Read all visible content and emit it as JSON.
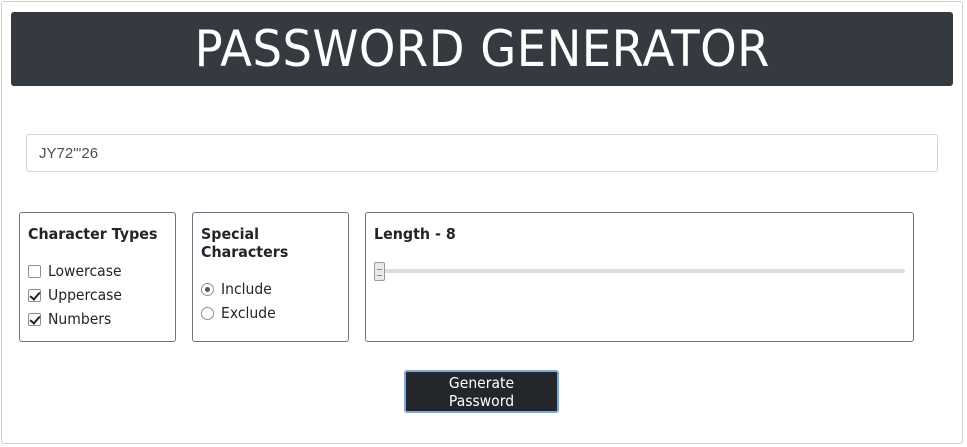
{
  "header": {
    "title": "PASSWORD GENERATOR"
  },
  "output": {
    "value": "JY72\"'26"
  },
  "character_types": {
    "heading": "Character Types",
    "options": [
      {
        "label": "Lowercase",
        "checked": false
      },
      {
        "label": "Uppercase",
        "checked": true
      },
      {
        "label": "Numbers",
        "checked": true
      }
    ]
  },
  "special_characters": {
    "heading": "Special Characters",
    "options": [
      {
        "label": "Include",
        "selected": true
      },
      {
        "label": "Exclude",
        "selected": false
      }
    ]
  },
  "length": {
    "heading": "Length - 8",
    "value": 8
  },
  "actions": {
    "generate_label": "Generate Password"
  },
  "colors": {
    "header_bg": "#343a40",
    "button_bg": "#23272b",
    "button_focus_ring": "#80a8d8"
  }
}
